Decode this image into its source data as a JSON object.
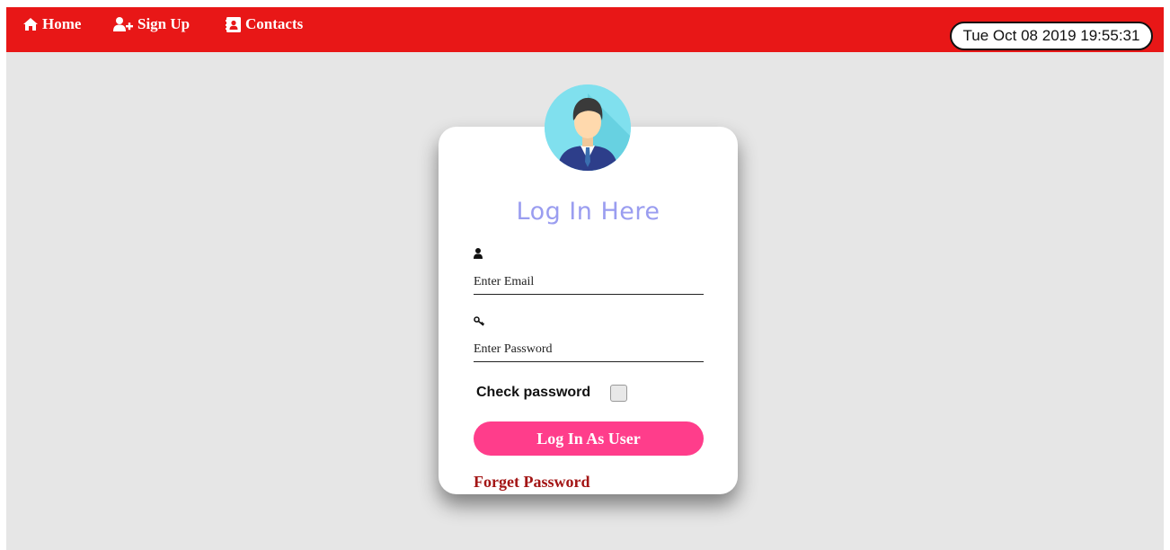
{
  "nav": {
    "items": [
      {
        "label": "Home",
        "icon": "home-icon"
      },
      {
        "label": "Sign Up",
        "icon": "user-plus-icon"
      },
      {
        "label": "Contacts",
        "icon": "address-book-icon"
      }
    ],
    "clock": "Tue Oct 08 2019 19:55:31"
  },
  "login": {
    "title": "Log In Here",
    "email_placeholder": "Enter Email",
    "email_icon": "user-icon",
    "password_placeholder": "Enter Password",
    "password_icon": "key-icon",
    "check_password_label": "Check password",
    "submit_label": "Log In As User",
    "forget_label": "Forget Password"
  },
  "colors": {
    "topbar": "#e81717",
    "page_background": "#e6e6e6",
    "title": "#9a9df0",
    "button": "#ff3d8b",
    "forget_link": "#a31515"
  }
}
